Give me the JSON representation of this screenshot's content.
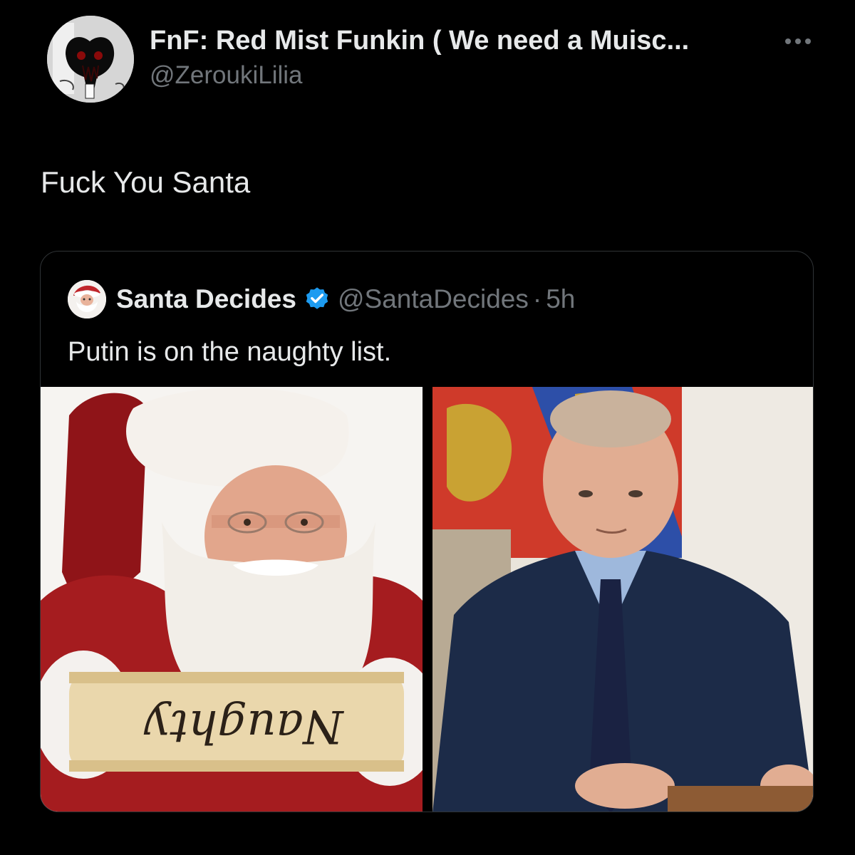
{
  "tweet": {
    "author_name": "FnF: Red Mist Funkin ( We need a Muisc...",
    "author_handle": "@ZeroukiLilia",
    "avatar_icon": "monster-avatar",
    "more_icon": "more-horizontal-icon",
    "text": "Fuck You Santa"
  },
  "quote": {
    "author_name": "Santa Decides",
    "verified_color": "#1d9bf0",
    "author_handle": "@SantaDecides",
    "separator": "·",
    "time": "5h",
    "text": "Putin is on the naughty list.",
    "media": [
      {
        "name": "santa-photo",
        "scroll_text": "Naughty"
      },
      {
        "name": "putin-photo"
      }
    ]
  },
  "colors": {
    "background": "#000000",
    "primary_text": "#e7e9ea",
    "secondary_text": "#71767b",
    "border": "#2f3336"
  }
}
